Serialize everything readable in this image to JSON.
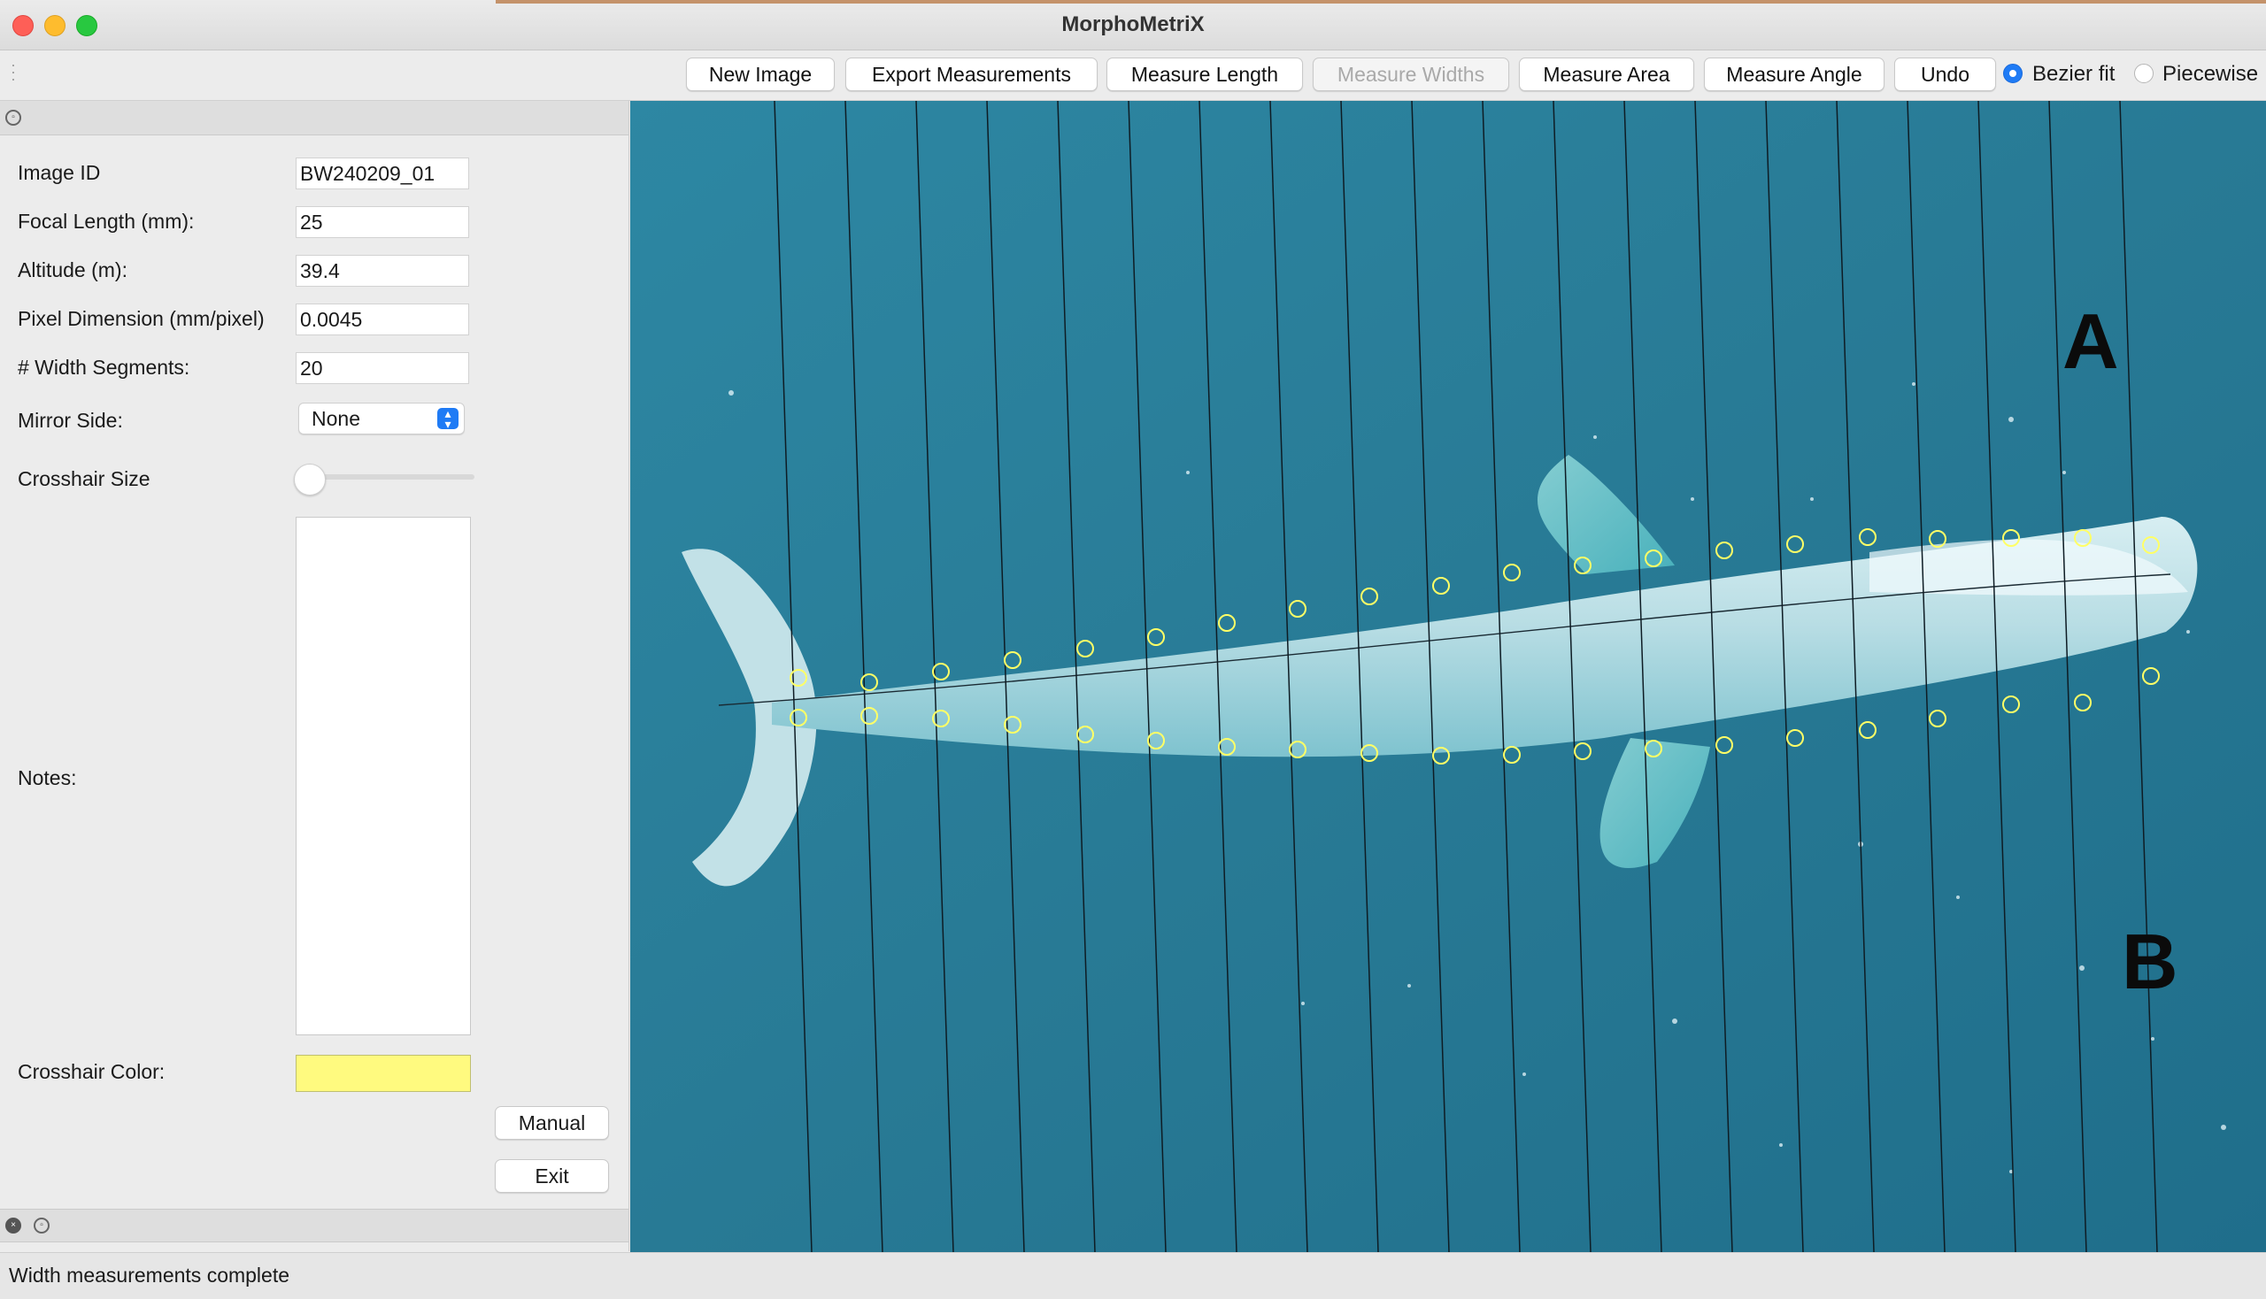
{
  "window": {
    "title": "MorphoMetriX"
  },
  "toolbar": {
    "buttons": [
      {
        "label": "New Image"
      },
      {
        "label": "Export Measurements"
      },
      {
        "label": "Measure Length"
      },
      {
        "label": "Measure Widths",
        "disabled": true
      },
      {
        "label": "Measure Area"
      },
      {
        "label": "Measure Angle"
      },
      {
        "label": "Undo"
      }
    ],
    "fit_options": [
      {
        "label": "Bezier fit",
        "selected": true
      },
      {
        "label": "Piecewise",
        "selected": false
      }
    ]
  },
  "panel": {
    "fields": [
      {
        "label": "Image ID",
        "value": "BW240209_01"
      },
      {
        "label": "Focal Length (mm):",
        "value": "25"
      },
      {
        "label": "Altitude (m):",
        "value": "39.4"
      },
      {
        "label": "Pixel Dimension (mm/pixel)",
        "value": "0.0045"
      },
      {
        "label": "# Width Segments:",
        "value": "20"
      }
    ],
    "mirror_side": {
      "label": "Mirror Side:",
      "value": "None"
    },
    "crosshair_size": {
      "label": "Crosshair Size",
      "value": 0
    },
    "notes": {
      "label": "Notes:",
      "value": ""
    },
    "crosshair_color": {
      "label": "Crosshair Color:",
      "value": "#fffa7f"
    },
    "manual_label": "Manual",
    "exit_label": "Exit"
  },
  "viewer": {
    "label_a": "A",
    "label_b": "B",
    "width_segments": 20
  },
  "status": {
    "text": "Width measurements complete"
  },
  "colors": {
    "accent": "#1f7bf5",
    "water": "#2a7d97",
    "crosshair": "#ffff66"
  }
}
